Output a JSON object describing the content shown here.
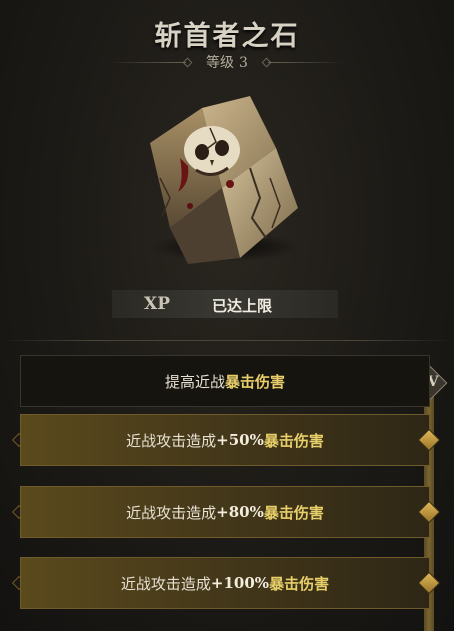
{
  "item": {
    "name": "斩首者之石",
    "rank_label": "等级",
    "rank_value": "3"
  },
  "xp": {
    "label": "XP",
    "status": "已达上限"
  },
  "perks": {
    "header": {
      "prefix": "提高近战",
      "highlight": "暴击伤害"
    },
    "level_badge": "LV",
    "tiers": [
      {
        "prefix": "近战攻击造成",
        "amount": "+50%",
        "highlight": "暴击伤害"
      },
      {
        "prefix": "近战攻击造成",
        "amount": "+80%",
        "highlight": "暴击伤害"
      },
      {
        "prefix": "近战攻击造成",
        "amount": "+100%",
        "highlight": "暴击伤害"
      }
    ]
  },
  "colors": {
    "highlight": "#e8cf6a",
    "tier_gold": "#5a4a1c"
  }
}
